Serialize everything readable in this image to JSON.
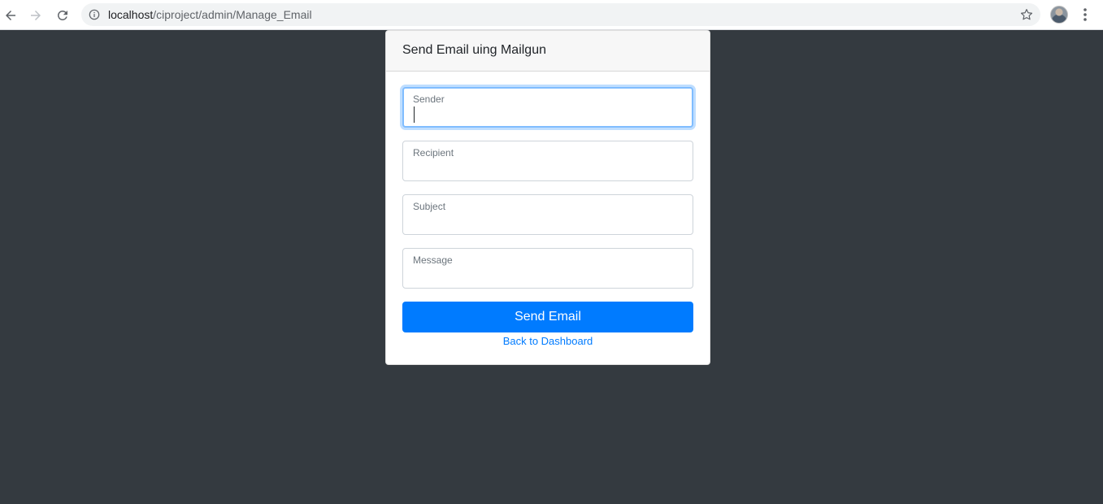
{
  "browser": {
    "url_host": "localhost",
    "url_path": "/ciproject/admin/Manage_Email"
  },
  "card": {
    "title": "Send Email uing Mailgun"
  },
  "form": {
    "fields": [
      {
        "label": "Sender",
        "value": ""
      },
      {
        "label": "Recipient",
        "value": ""
      },
      {
        "label": "Subject",
        "value": ""
      },
      {
        "label": "Message",
        "value": ""
      }
    ],
    "submit_label": "Send Email",
    "back_link_label": "Back to Dashboard"
  },
  "colors": {
    "page_background": "#343a40",
    "primary": "#007bff",
    "focus_border": "#80bdff"
  }
}
